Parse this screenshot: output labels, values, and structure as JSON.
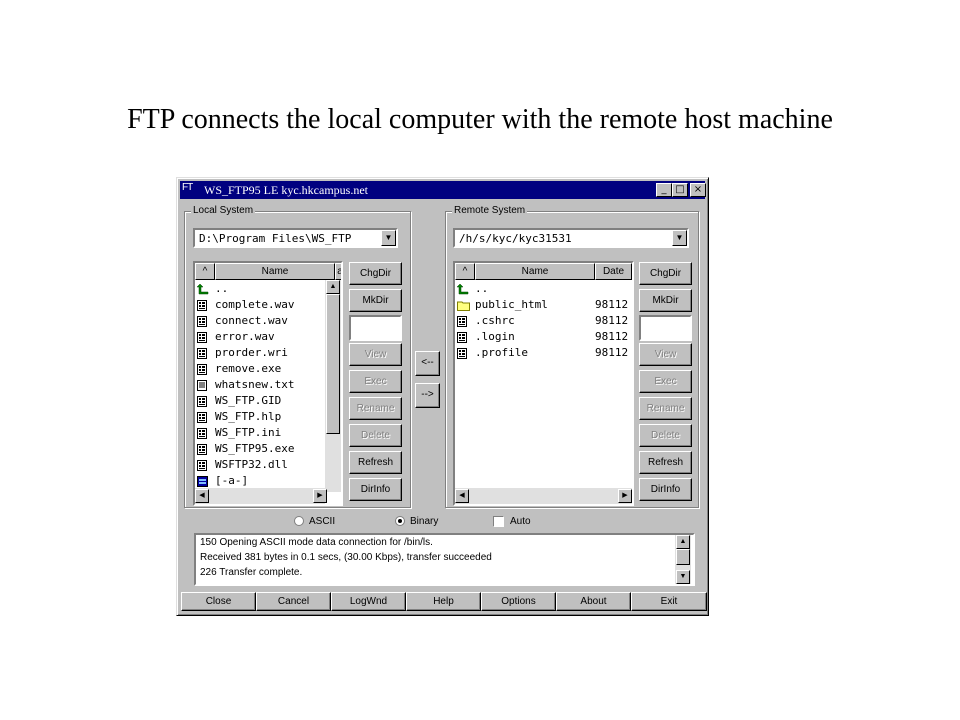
{
  "slide": {
    "title": "FTP connects the local computer with the remote host machine"
  },
  "window": {
    "icon_text": "FT",
    "title": "WS_FTP95 LE kyc.hkcampus.net",
    "min_label": "_",
    "max_label": "□",
    "close_label": "×"
  },
  "local": {
    "label": "Local System",
    "path": "D:\\Program Files\\WS_FTP",
    "headers": {
      "up": "^",
      "name": "Name",
      "extra": "a"
    },
    "files": [
      {
        "name": "..",
        "icon": "up-folder-icon"
      },
      {
        "name": "complete.wav",
        "icon": "file-icon"
      },
      {
        "name": "connect.wav",
        "icon": "file-icon"
      },
      {
        "name": "error.wav",
        "icon": "file-icon"
      },
      {
        "name": "prorder.wri",
        "icon": "file-icon"
      },
      {
        "name": "remove.exe",
        "icon": "file-icon"
      },
      {
        "name": "whatsnew.txt",
        "icon": "text-file-icon"
      },
      {
        "name": "WS_FTP.GID",
        "icon": "file-icon"
      },
      {
        "name": "WS_FTP.hlp",
        "icon": "file-icon"
      },
      {
        "name": "WS_FTP.ini",
        "icon": "file-icon"
      },
      {
        "name": "WS_FTP95.exe",
        "icon": "file-icon"
      },
      {
        "name": "WSFTP32.dll",
        "icon": "file-icon"
      },
      {
        "name": "[-a-]",
        "icon": "drive-icon"
      }
    ],
    "buttons": [
      "ChgDir",
      "MkDir",
      "View",
      "Exec",
      "Rename",
      "Delete",
      "Refresh",
      "DirInfo"
    ]
  },
  "remote": {
    "label": "Remote System",
    "path": "/h/s/kyc/kyc31531",
    "headers": {
      "up": "^",
      "name": "Name",
      "date": "Date"
    },
    "files": [
      {
        "name": "..",
        "date": "",
        "icon": "up-folder-icon"
      },
      {
        "name": "public_html",
        "date": "98112",
        "icon": "folder-icon"
      },
      {
        "name": ".cshrc",
        "date": "98112",
        "icon": "file-icon"
      },
      {
        "name": ".login",
        "date": "98112",
        "icon": "file-icon"
      },
      {
        "name": ".profile",
        "date": "98112",
        "icon": "file-icon"
      }
    ],
    "buttons": [
      "ChgDir",
      "MkDir",
      "View",
      "Exec",
      "Rename",
      "Delete",
      "Refresh",
      "DirInfo"
    ]
  },
  "transfer": {
    "to_local": "<--",
    "to_remote": "-->"
  },
  "mode": {
    "ascii": "ASCII",
    "binary": "Binary",
    "auto": "Auto",
    "selected": "Binary"
  },
  "log": [
    "150 Opening ASCII mode data connection for /bin/ls.",
    "Received 381 bytes in 0.1 secs, (30.00 Kbps), transfer succeeded",
    "226 Transfer complete."
  ],
  "bottom_buttons": [
    "Close",
    "Cancel",
    "LogWnd",
    "Help",
    "Options",
    "About",
    "Exit"
  ]
}
